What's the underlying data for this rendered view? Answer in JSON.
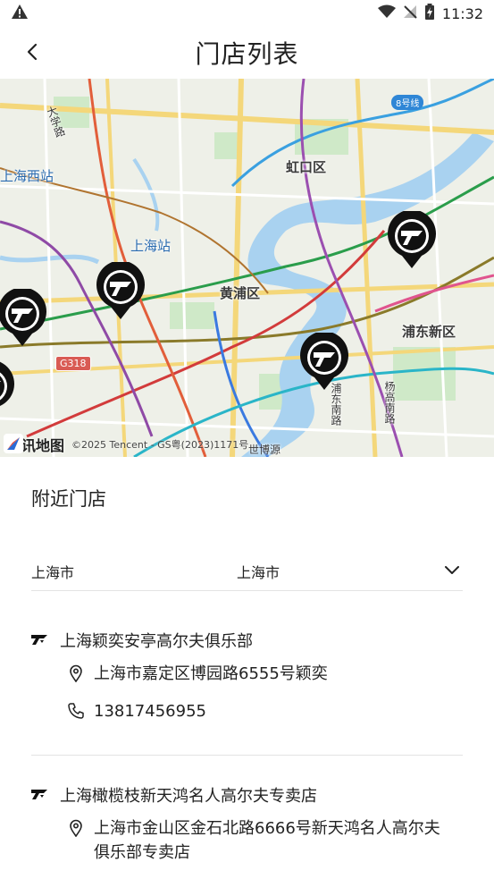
{
  "status": {
    "time": "11:32"
  },
  "nav": {
    "title": "门店列表"
  },
  "map": {
    "labels": {
      "hongkou": "虹口区",
      "huangpu": "黄浦区",
      "pudong": "浦东新区",
      "shanghai_west": "上海西站",
      "shanghai_station": "上海站",
      "line8": "8号线",
      "g318": "G318",
      "pudong_south": "浦东南路",
      "yanggao_south": "杨高南路",
      "shijiyuan": "世博源",
      "daxue_road": "大学路"
    },
    "logo_text": "腾讯地图",
    "copyright": "©2025 Tencent - GS粤(2023)1171号"
  },
  "nearby": {
    "title": "附近门店",
    "province": "上海市",
    "city": "上海市"
  },
  "stores": [
    {
      "name": "上海颖奕安亭高尔夫俱乐部",
      "address": "上海市嘉定区博园路6555号颖奕",
      "phone": "13817456955"
    },
    {
      "name": "上海橄榄枝新天鸿名人高尔夫专卖店",
      "address": "上海市金山区金石北路6666号新天鸿名人高尔夫俱乐部专卖店"
    }
  ]
}
